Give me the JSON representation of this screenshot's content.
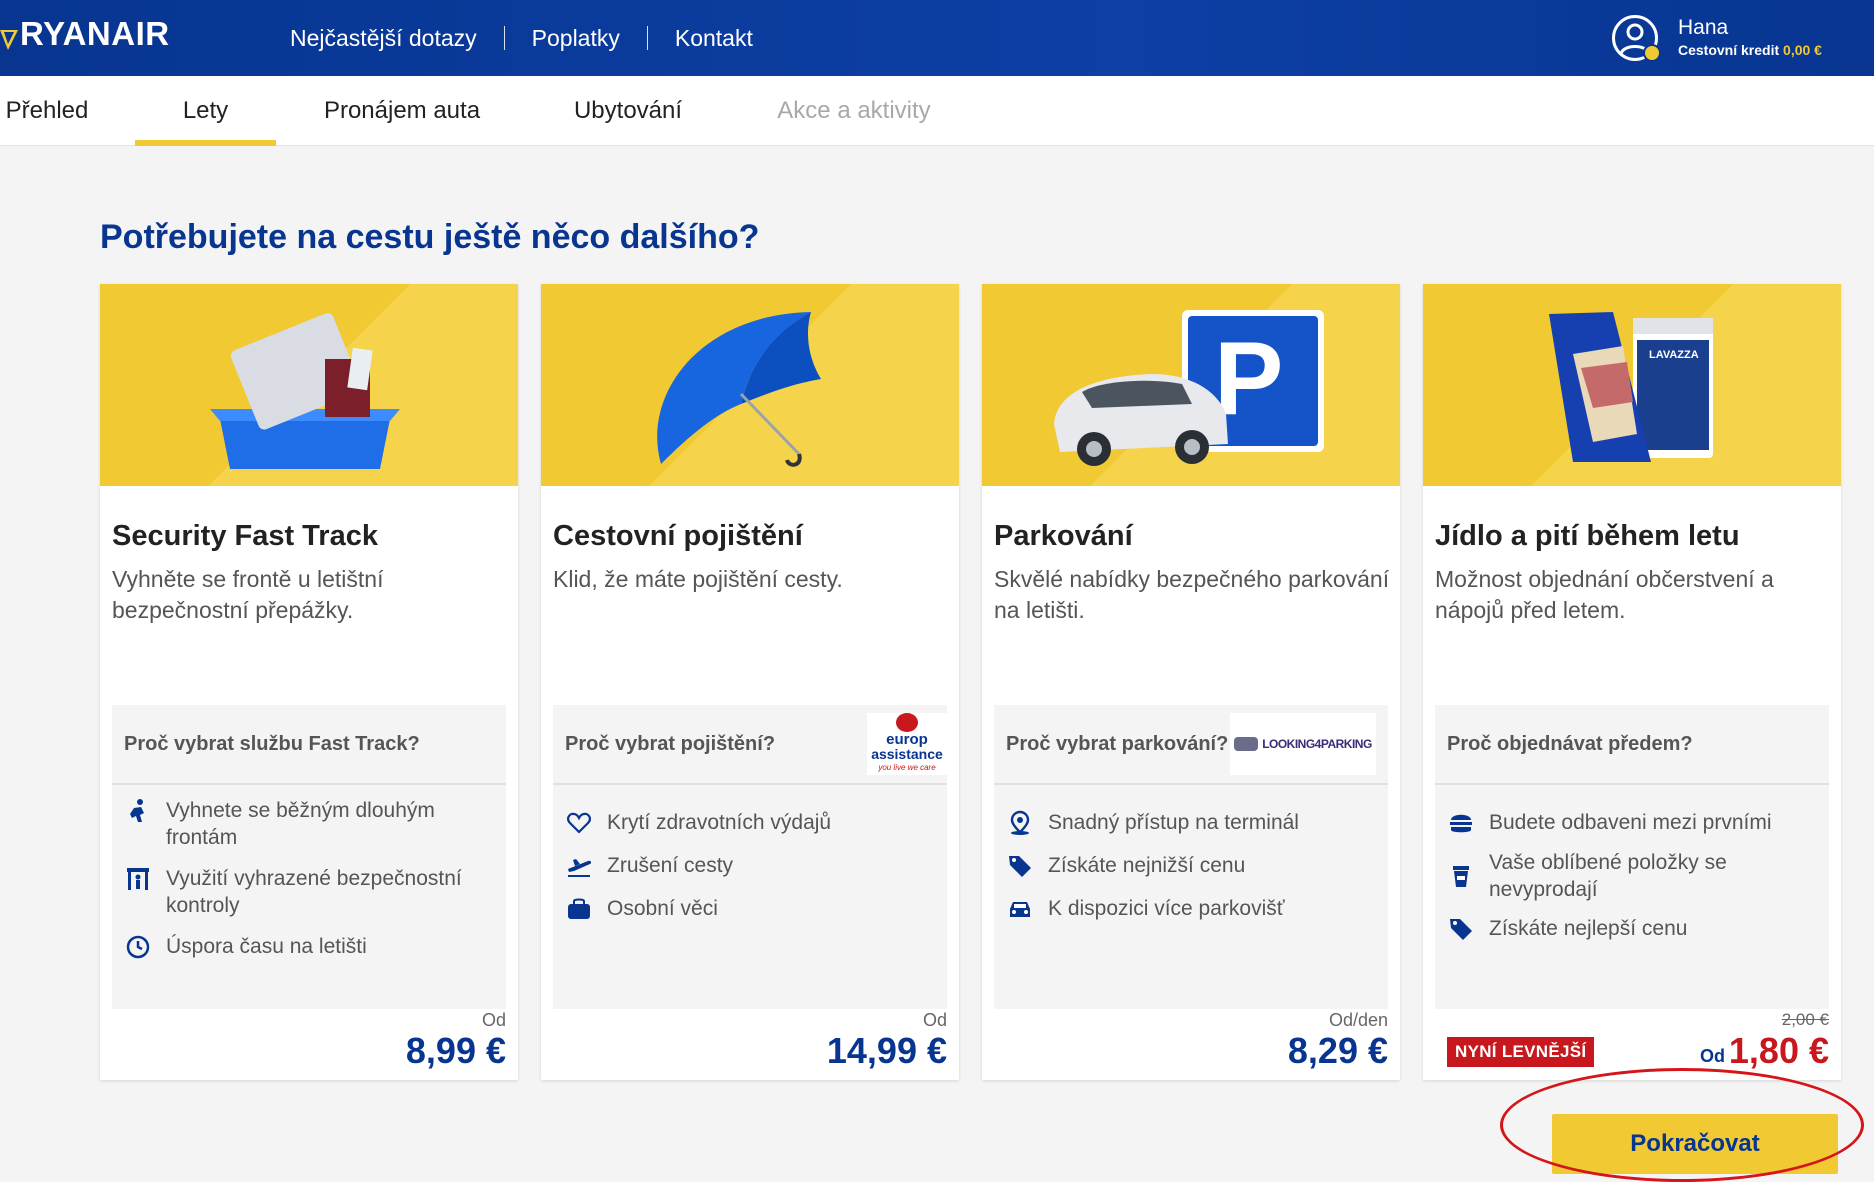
{
  "brand": {
    "name": "RYANAIR"
  },
  "topnav": {
    "items": [
      {
        "label": "Nejčastější dotazy"
      },
      {
        "label": "Poplatky"
      },
      {
        "label": "Kontakt"
      }
    ]
  },
  "user": {
    "name": "Hana",
    "credit_label": "Cestovní kredit",
    "credit_amount": "0,00 €"
  },
  "subnav": {
    "tabs": [
      {
        "label": "Přehled",
        "state": "normal"
      },
      {
        "label": "Lety",
        "state": "active"
      },
      {
        "label": "Pronájem auta",
        "state": "normal"
      },
      {
        "label": "Ubytování",
        "state": "normal"
      },
      {
        "label": "Akce a aktivity",
        "state": "disabled"
      }
    ]
  },
  "headline": "Potřebujete na cestu ještě něco dalšího?",
  "cards": [
    {
      "title": "Security Fast Track",
      "description": "Vyhněte se frontě u letištní bezpečnostní přepážky.",
      "why_heading": "Proč vybrat službu Fast Track?",
      "features": [
        {
          "icon": "running-person-icon",
          "text": "Vyhnete se běžným dlouhým frontám"
        },
        {
          "icon": "security-gate-icon",
          "text": "Využití vyhrazené bezpečnostní kontroly"
        },
        {
          "icon": "clock-icon",
          "text": "Úspora času na letišti"
        }
      ],
      "price_prefix": "Od",
      "price": "8,99 €"
    },
    {
      "title": "Cestovní pojištění",
      "description": "Klid, že máte pojištění cesty.",
      "why_heading": "Proč vybrat pojištění?",
      "partner": {
        "line1": "europ",
        "line2": "assistance",
        "tagline": "you live we care"
      },
      "features": [
        {
          "icon": "heart-icon",
          "text": "Krytí zdravotních výdajů"
        },
        {
          "icon": "plane-takeoff-icon",
          "text": "Zrušení cesty"
        },
        {
          "icon": "bag-icon",
          "text": "Osobní věci"
        }
      ],
      "price_prefix": "Od",
      "price": "14,99 €"
    },
    {
      "title": "Parkování",
      "description": "Skvělé nabídky bezpečného parkování na letišti.",
      "why_heading": "Proč vybrat parkování?",
      "partner": {
        "name": "LOOKING4PARKING"
      },
      "features": [
        {
          "icon": "location-pin-icon",
          "text": "Snadný přístup na terminál"
        },
        {
          "icon": "price-tag-icon",
          "text": "Získáte nejnižší cenu"
        },
        {
          "icon": "car-icon",
          "text": "K dispozici více parkovišť"
        }
      ],
      "price_prefix": "Od/den",
      "price": "8,29 €"
    },
    {
      "title": "Jídlo a pití během letu",
      "description": "Možnost objednání občerstvení a nápojů před letem.",
      "why_heading": "Proč objednávat předem?",
      "features": [
        {
          "icon": "burger-icon",
          "text": "Budete odbaveni mezi prvními"
        },
        {
          "icon": "coffee-cup-icon",
          "text": "Vaše oblíbené položky se nevyprodají"
        },
        {
          "icon": "price-tag-icon",
          "text": "Získáte nejlepší cenu"
        }
      ],
      "badge": "NYNÍ LEVNĚJŠÍ",
      "old_price": "2,00 €",
      "price_prefix": "Od",
      "price": "1,80 €"
    }
  ],
  "continue_label": "Pokračovat",
  "colors": {
    "brand_blue": "#073590",
    "yellow": "#f1c933",
    "red": "#c8171d"
  }
}
